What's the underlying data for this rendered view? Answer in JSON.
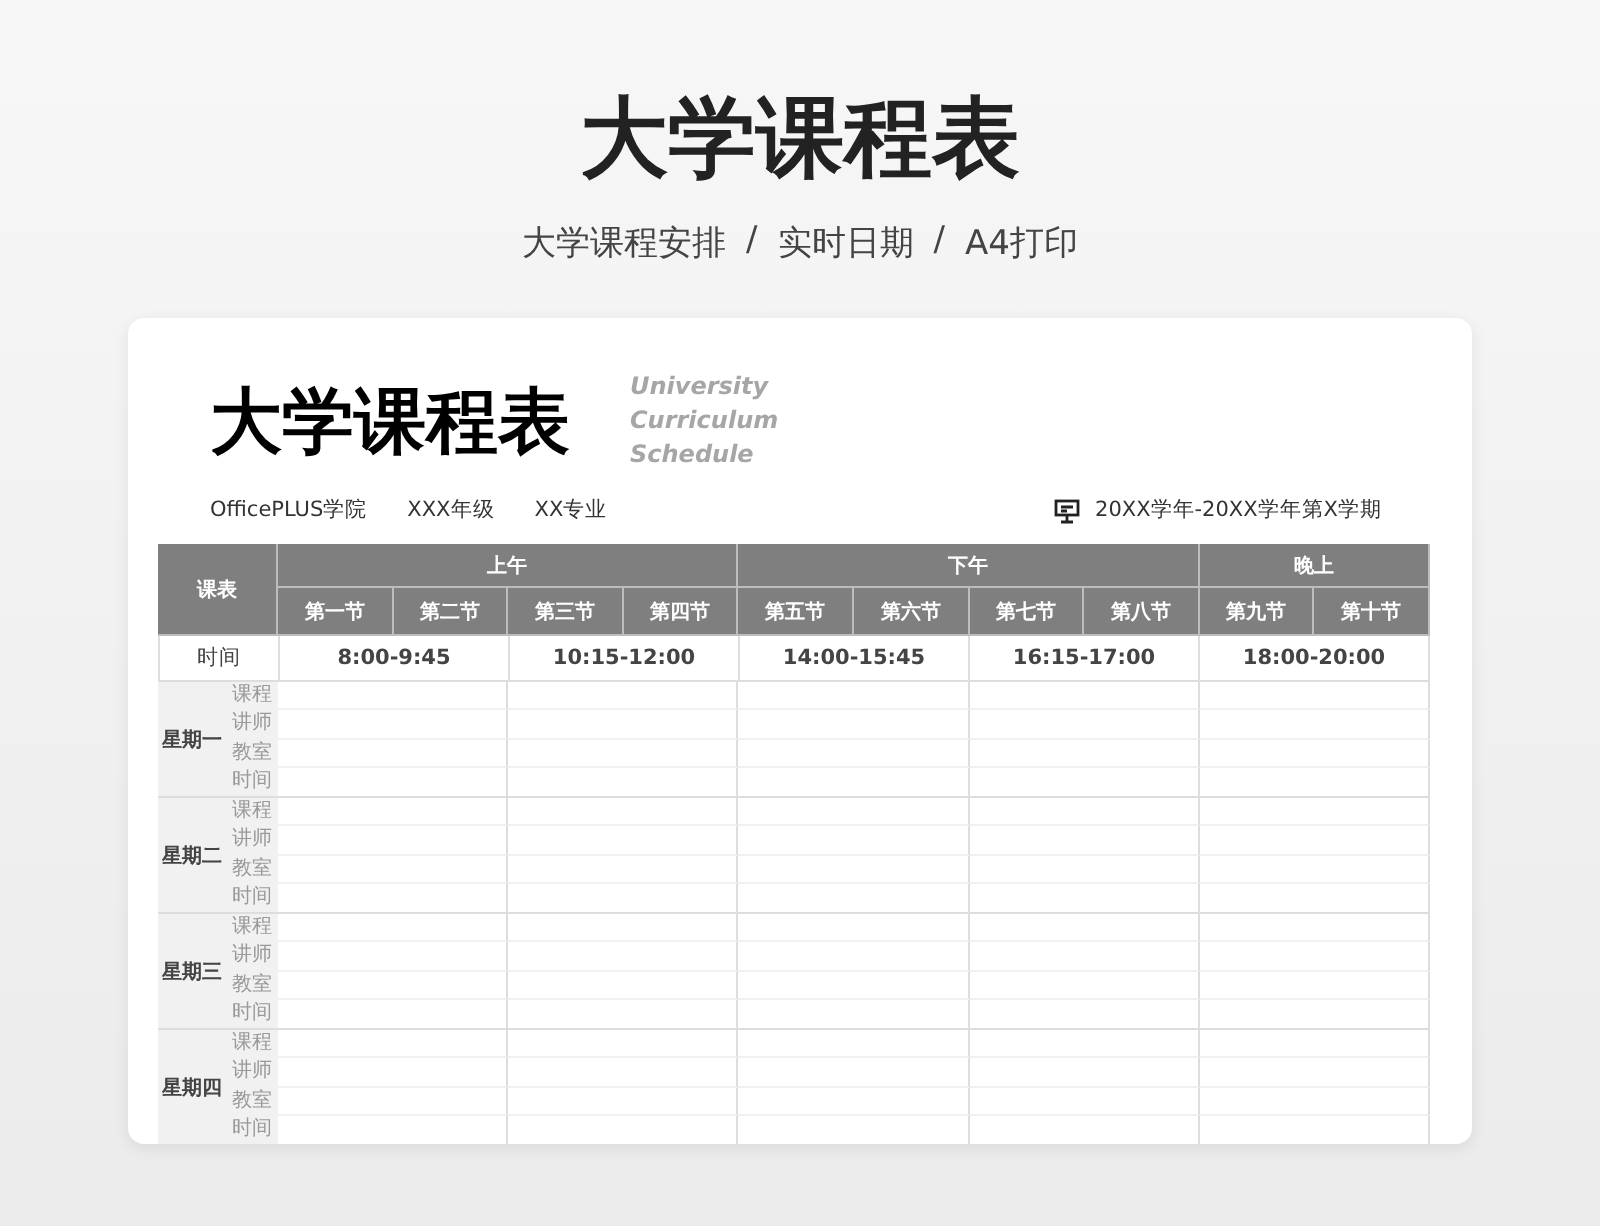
{
  "page_title": "大学课程表",
  "subtitle": [
    "大学课程安排",
    "/",
    "实时日期",
    "/",
    "A4打印"
  ],
  "card": {
    "title": "大学课程表",
    "english_title": [
      "University",
      "Curriculum",
      "Schedule"
    ],
    "info": [
      "OfficePLUS学院",
      "XXX年级",
      "XX专业"
    ],
    "term": "20XX学年-20XX学年第X学期"
  },
  "table": {
    "corner": "课表",
    "periods": [
      {
        "label": "上午",
        "sessions": [
          "第一节",
          "第二节",
          "第三节",
          "第四节"
        ]
      },
      {
        "label": "下午",
        "sessions": [
          "第五节",
          "第六节",
          "第七节",
          "第八节"
        ]
      },
      {
        "label": "晚上",
        "sessions": [
          "第九节",
          "第十节"
        ]
      }
    ],
    "time_label": "时间",
    "times": [
      "8:00-9:45",
      "10:15-12:00",
      "14:00-15:45",
      "16:15-17:00",
      "18:00-20:00"
    ],
    "days": [
      {
        "label": "星期一",
        "fields": [
          "课程",
          "讲师",
          "教室",
          "时间"
        ]
      },
      {
        "label": "星期二",
        "fields": [
          "课程",
          "讲师",
          "教室",
          "时间"
        ]
      },
      {
        "label": "星期三",
        "fields": [
          "课程",
          "讲师",
          "教室",
          "时间"
        ]
      },
      {
        "label": "星期四",
        "fields": [
          "课程",
          "讲师",
          "教室",
          "时间"
        ]
      }
    ]
  }
}
